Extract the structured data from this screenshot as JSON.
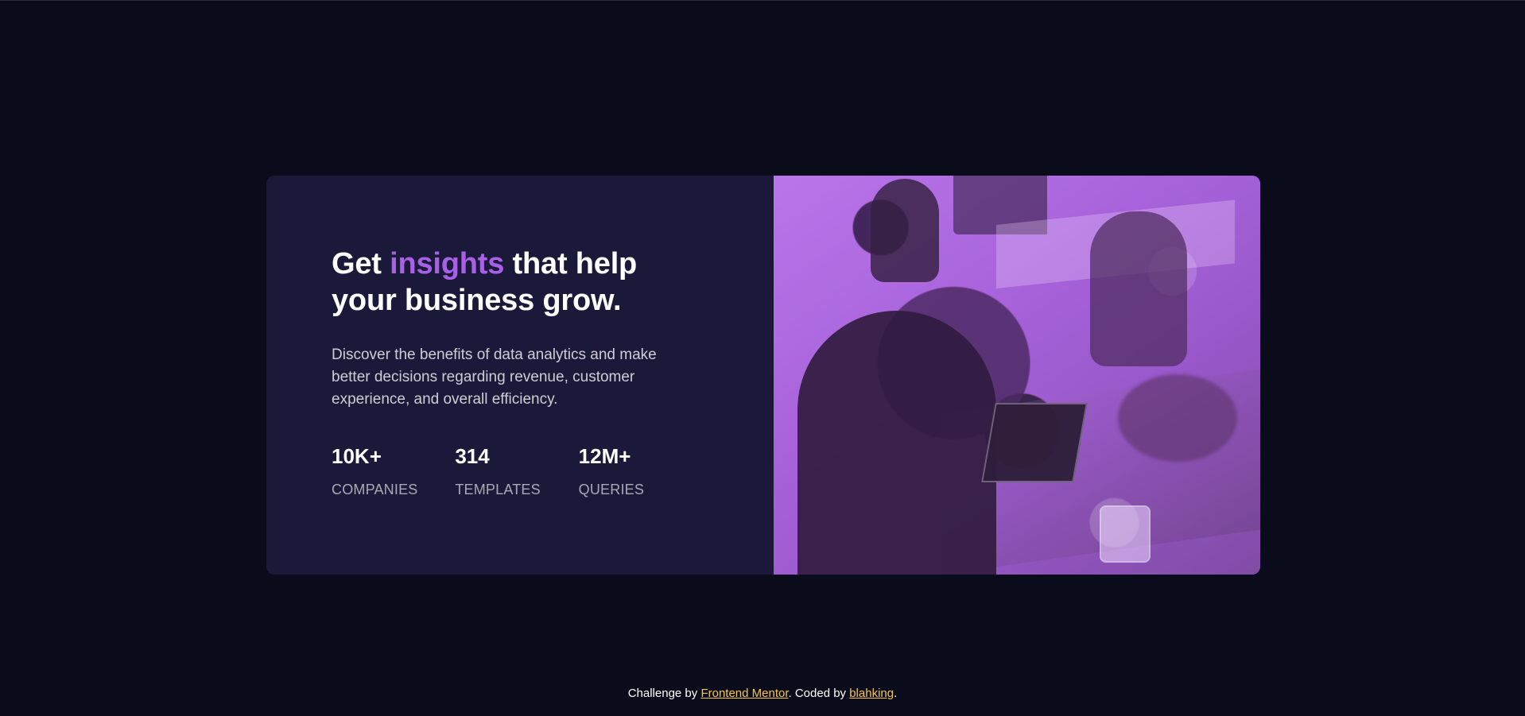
{
  "hero": {
    "headline": {
      "prefix": "Get ",
      "accent": "insights",
      "suffix": " that help your business grow."
    },
    "description": "Discover the benefits of data analytics and make better decisions regarding revenue, customer experience, and overall efficiency.",
    "stats": [
      {
        "value": "10K+",
        "label": "COMPANIES"
      },
      {
        "value": "314",
        "label": "TEMPLATES"
      },
      {
        "value": "12M+",
        "label": "QUERIES"
      }
    ]
  },
  "footer": {
    "prefix": "Challenge by ",
    "frontend_mentor": "Frontend Mentor",
    "middle": ". Coded by ",
    "author": "blahking",
    "suffix": "."
  },
  "colors": {
    "background": "#0a0c1b",
    "card": "#1b1939",
    "accent": "#a760e6",
    "footer_link": "#f7c646"
  },
  "icons": {}
}
